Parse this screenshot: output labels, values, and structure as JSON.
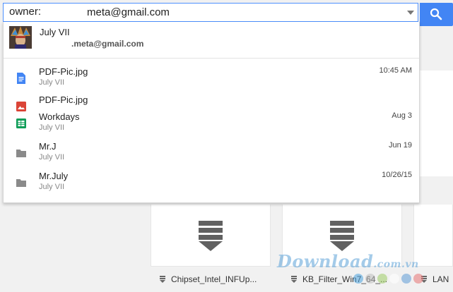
{
  "search": {
    "operator": "owner:",
    "query": "meta@gmail.com"
  },
  "suggestions": {
    "person": {
      "name": "July VII",
      "email": ".meta@gmail.com"
    },
    "results": [
      {
        "title": "PDF-Pic.jpg",
        "owner": "July VII",
        "date": "10:45 AM",
        "icon": "google-docs-icon"
      },
      {
        "title": "PDF-Pic.jpg",
        "owner": "",
        "date": "",
        "icon": "image-file-icon"
      },
      {
        "title": "Workdays",
        "owner": "July VII",
        "date": "Aug 3",
        "icon": "google-sheets-icon"
      },
      {
        "title": "Mr.J",
        "owner": "July VII",
        "date": "Jun 19",
        "icon": "folder-icon"
      },
      {
        "title": "Mr.July",
        "owner": "July VII",
        "date": "10/26/15",
        "icon": "folder-icon"
      }
    ]
  },
  "files": [
    {
      "name": "Chipset_Intel_INFUp..."
    },
    {
      "name": "KB_Filter_Win7_64_..."
    },
    {
      "name": "LAN"
    }
  ],
  "watermark": {
    "brand": "Download",
    "suffix": ".com.vn"
  },
  "colors": {
    "accent": "#4285f4",
    "docs": "#4285f4",
    "image": "#db4437",
    "sheets": "#0f9d58",
    "folder": "#8a8a8a"
  }
}
